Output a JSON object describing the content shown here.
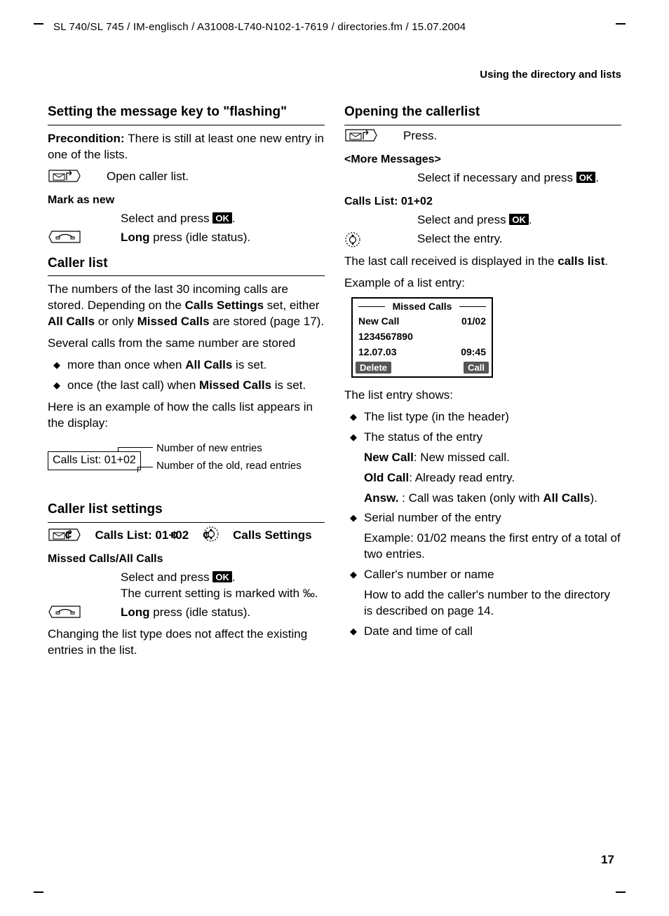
{
  "header": {
    "path": "SL 740/SL 745 / IM-englisch / A31008-L740-N102-1-7619 / directories.fm / 15.07.2004",
    "running_head": "Using the directory and lists"
  },
  "page_number": "17",
  "ok_label": "OK",
  "left": {
    "h_flashing": "Setting the message key to \"flashing\"",
    "precond_label": "Precondition: ",
    "precond_text": "There is still at least one new entry in one of the lists.",
    "open_caller_list": "Open caller list.",
    "mark_as_new": "Mark as new",
    "select_press": "Select and press ",
    "long_label": "Long",
    "long_rest": " press (idle status).",
    "h_callerlist": "Caller list",
    "p_cl1a": "The numbers of the last 30 incoming calls are stored. Depending on the ",
    "p_cl1b": "Calls Settings",
    "p_cl1c": " set, either ",
    "p_cl1d": "All Calls",
    "p_cl1e": " or only ",
    "p_cl1f": "Missed Calls",
    "p_cl1g": " are stored (page 17).",
    "p_cl2": "Several calls from the same number are stored",
    "li_cl_a_pre": "more than once when ",
    "li_cl_a_bold": "All Calls",
    "li_cl_a_post": " is set.",
    "li_cl_b_pre": "once (the last call) when ",
    "li_cl_b_bold": "Missed Calls",
    "li_cl_b_post": " is set.",
    "p_cl3": "Here is an example of how the calls list appears in the display:",
    "callout": {
      "box": "Calls List:  01+02",
      "line1": "Number of new entries",
      "line2": "Number of the old, read entries"
    },
    "h_settings": "Caller list settings",
    "nav": {
      "step2": "Calls List:  01+02",
      "step4": "Calls Settings"
    },
    "missed_all": "Missed Calls/All Calls",
    "select_press2": "Select and press ",
    "current_marked": "The current setting is marked with ",
    "check_glyph": "‰",
    "long2_label": "Long",
    "long2_rest": " press (idle status).",
    "p_change_note": "Changing the list type does not affect the existing entries in the list."
  },
  "right": {
    "h_open": "Opening the callerlist",
    "press": "Press.",
    "more_msgs": "<More Messages>",
    "select_if": "Select if necessary and press ",
    "calls_list_label": "Calls List: 01+02",
    "select_press": "Select and press ",
    "select_entry": "Select the entry.",
    "last_call_a": "The last call received is displayed in the ",
    "last_call_b": "calls list",
    "last_call_c": ".",
    "example_label": "Example of a list entry:",
    "display": {
      "head": "Missed Calls",
      "r1l": "New Call",
      "r1r": "01/02",
      "r2l": "1234567890",
      "r3l": "12.07.03",
      "r3r": "09:45",
      "sk_left": "Delete",
      "sk_right": "Call"
    },
    "shows_label": "The list entry shows:",
    "li1": "The list type (in the header)",
    "li2": "The status of the entry",
    "li2_a": "New Call",
    "li2_a2": ": New missed call.",
    "li2_b": "Old Call",
    "li2_b2": ": Already read entry.",
    "li2_c": "Answ. ",
    "li2_c2": ": Call was taken (only with ",
    "li2_c3": "All Calls",
    "li2_c4": ").",
    "li3": "Serial number of the entry",
    "li3_sub": "Example: 01/02 means the first entry of a total of two entries.",
    "li4": "Caller's number or name",
    "li4_sub": "How to add the caller's number to the directory is described on page 14.",
    "li5": "Date and time of call"
  }
}
